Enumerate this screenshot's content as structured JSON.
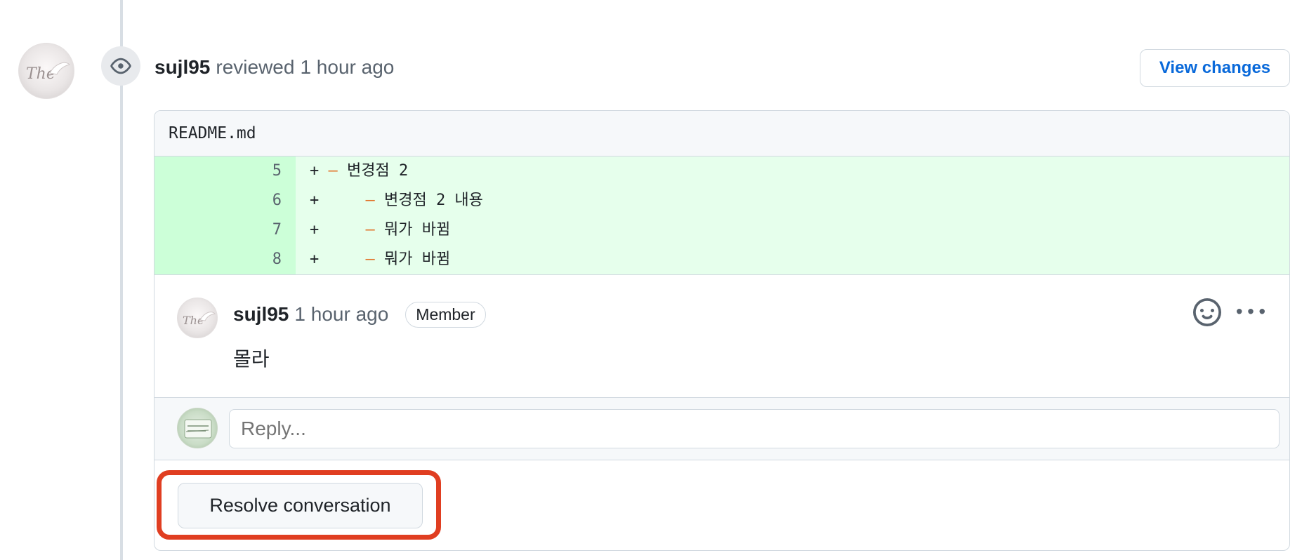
{
  "review": {
    "author": "sujl95",
    "action": "reviewed",
    "time": "1 hour ago",
    "view_changes_label": "View changes"
  },
  "file": {
    "name": "README.md",
    "lines": [
      {
        "num": "5",
        "prefix": "+ ",
        "indent": "",
        "dash": "–",
        "text": " 변경점 2"
      },
      {
        "num": "6",
        "prefix": "+ ",
        "indent": "    ",
        "dash": "–",
        "text": " 변경점 2 내용"
      },
      {
        "num": "7",
        "prefix": "+ ",
        "indent": "    ",
        "dash": "–",
        "text": " 뭐가 바뀜"
      },
      {
        "num": "8",
        "prefix": "+ ",
        "indent": "    ",
        "dash": "–",
        "text": " 뭐가 바뀜"
      }
    ]
  },
  "comment": {
    "author": "sujl95",
    "time": "1 hour ago",
    "badge": "Member",
    "body": "몰라"
  },
  "reply": {
    "placeholder": "Reply..."
  },
  "resolve": {
    "label": "Resolve conversation"
  },
  "icons": {
    "eye": "eye-icon",
    "smiley": "smiley-icon",
    "kebab": "kebab-horizontal-icon"
  },
  "colors": {
    "highlight": "#e03e21",
    "addition_num_bg": "#ccffd8",
    "addition_code_bg": "#e6ffec",
    "link": "#0969da"
  }
}
